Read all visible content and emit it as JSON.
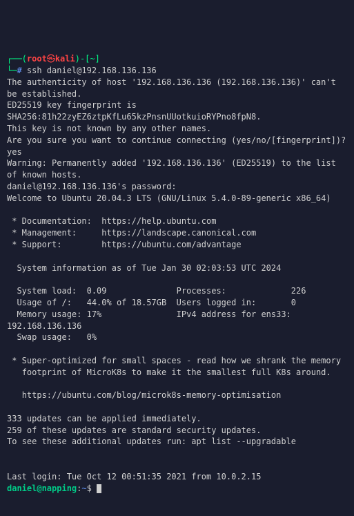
{
  "prompt1": {
    "open_paren": "┌──(",
    "user": "root",
    "at": "㉿",
    "host": "kali",
    "close_paren": ")-[",
    "path": "~",
    "close_bracket": "]",
    "line2_prefix": "└─",
    "hash": "#",
    "command": " ssh daniel@192.168.136.136"
  },
  "output": {
    "line1": "The authenticity of host '192.168.136.136 (192.168.136.136)' can't be established.",
    "line2": "ED25519 key fingerprint is SHA256:81h22zyEZ6ztpKfLu65kzPnsnUUotkuioRYPno8fpN8.",
    "line3": "This key is not known by any other names.",
    "line4": "Are you sure you want to continue connecting (yes/no/[fingerprint])? yes",
    "line5": "Warning: Permanently added '192.168.136.136' (ED25519) to the list of known hosts.",
    "line6": "daniel@192.168.136.136's password:",
    "line7": "Welcome to Ubuntu 20.04.3 LTS (GNU/Linux 5.4.0-89-generic x86_64)",
    "blank1": "",
    "line8": " * Documentation:  https://help.ubuntu.com",
    "line9": " * Management:     https://landscape.canonical.com",
    "line10": " * Support:        https://ubuntu.com/advantage",
    "blank2": "",
    "line11": "  System information as of Tue Jan 30 02:03:53 UTC 2024",
    "blank3": "",
    "line12": "  System load:  0.09              Processes:             226",
    "line13": "  Usage of /:   44.0% of 18.57GB  Users logged in:       0",
    "line14": "  Memory usage: 17%               IPv4 address for ens33: 192.168.136.136",
    "line15": "  Swap usage:   0%",
    "blank4": "",
    "line16": " * Super-optimized for small spaces - read how we shrank the memory",
    "line17": "   footprint of MicroK8s to make it the smallest full K8s around.",
    "blank5": "",
    "line18": "   https://ubuntu.com/blog/microk8s-memory-optimisation",
    "blank6": "",
    "line19": "333 updates can be applied immediately.",
    "line20": "259 of these updates are standard security updates.",
    "line21": "To see these additional updates run: apt list --upgradable",
    "blank7": "",
    "blank8": "",
    "line22": "Last login: Tue Oct 12 00:51:35 2021 from 10.0.2.15"
  },
  "prompt2": {
    "userhost": "daniel@napping",
    "colon": ":",
    "path": "~",
    "dollar": "$ "
  }
}
